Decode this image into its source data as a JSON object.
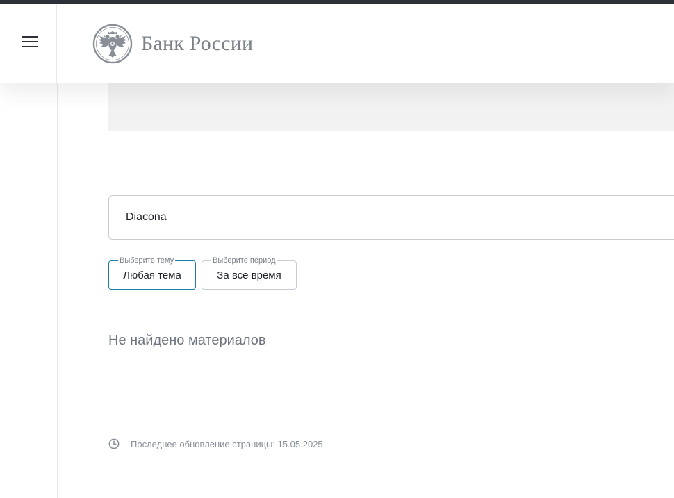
{
  "header": {
    "bank_name": "Банк России",
    "menu_icon": "hamburger-menu-icon",
    "logo_icon": "double-headed-eagle-emblem"
  },
  "search": {
    "value": "Diacona",
    "placeholder": ""
  },
  "filters": {
    "theme": {
      "legend": "Выберите тему",
      "value": "Любая тема"
    },
    "period": {
      "legend": "Выберите период",
      "value": "За все время"
    }
  },
  "results": {
    "empty_message": "Не найдено материалов"
  },
  "footer": {
    "last_update": "Последнее обновление страницы: 15.05.2025",
    "clock_icon": "clock-icon"
  },
  "colors": {
    "accent": "#1a7ea6",
    "logo_gray": "#7c8189",
    "text": "#1f2229",
    "muted_text": "#8a9099",
    "border": "#c9cdd3",
    "banner_bg": "#f2f2f3"
  }
}
